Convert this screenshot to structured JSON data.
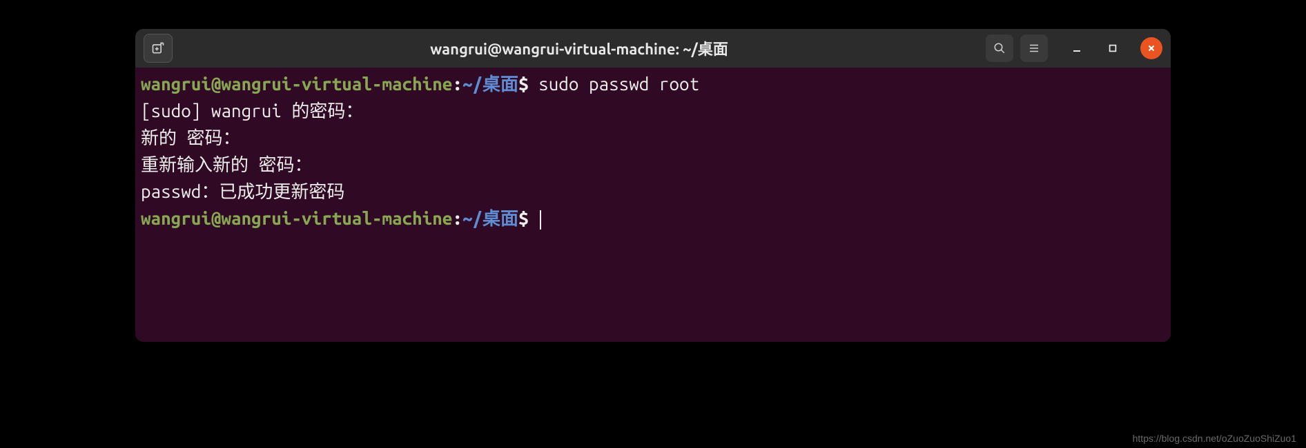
{
  "titlebar": {
    "title": "wangrui@wangrui-virtual-machine: ~/桌面"
  },
  "prompt": {
    "user_host": "wangrui@wangrui-virtual-machine",
    "colon": ":",
    "path": "~/桌面",
    "symbol": "$"
  },
  "lines": {
    "cmd1": " sudo passwd root",
    "out1": "[sudo] wangrui 的密码：",
    "out2": "新的 密码：",
    "out3": "重新输入新的 密码：",
    "out4": "passwd：已成功更新密码",
    "cmd2": " "
  },
  "watermark": "https://blog.csdn.net/oZuoZuoShiZuo1"
}
